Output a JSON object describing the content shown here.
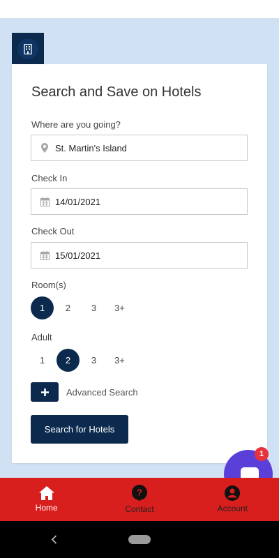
{
  "colors": {
    "primary": "#0b2a4e",
    "accent_nav": "#d91e1e",
    "page_bg": "#cfe1f2",
    "chat": "#5b3fd9",
    "badge": "#e8323c"
  },
  "header_tab": {
    "icon": "hotel-building-icon"
  },
  "form": {
    "title": "Search and Save on Hotels",
    "destination": {
      "label": "Where are you going?",
      "value": "St. Martin's Island",
      "icon": "location-pin-icon"
    },
    "check_in": {
      "label": "Check In",
      "value": "14/01/2021",
      "icon": "calendar-icon"
    },
    "check_out": {
      "label": "Check Out",
      "value": "15/01/2021",
      "icon": "calendar-icon"
    },
    "rooms": {
      "label": "Room(s)",
      "options": [
        "1",
        "2",
        "3",
        "3+"
      ],
      "selected": "1"
    },
    "adult": {
      "label": "Adult",
      "options": [
        "1",
        "2",
        "3",
        "3+"
      ],
      "selected": "2"
    },
    "advanced_search": {
      "label": "Advanced Search",
      "icon": "plus-icon"
    },
    "submit_label": "Search for Hotels"
  },
  "chat": {
    "badge_count": "1"
  },
  "bottom_nav": {
    "items": [
      {
        "label": "Home",
        "icon": "home-icon",
        "active": true
      },
      {
        "label": "Contact",
        "icon": "question-circle-icon",
        "active": false
      },
      {
        "label": "Account",
        "icon": "account-circle-icon",
        "active": false
      }
    ]
  }
}
